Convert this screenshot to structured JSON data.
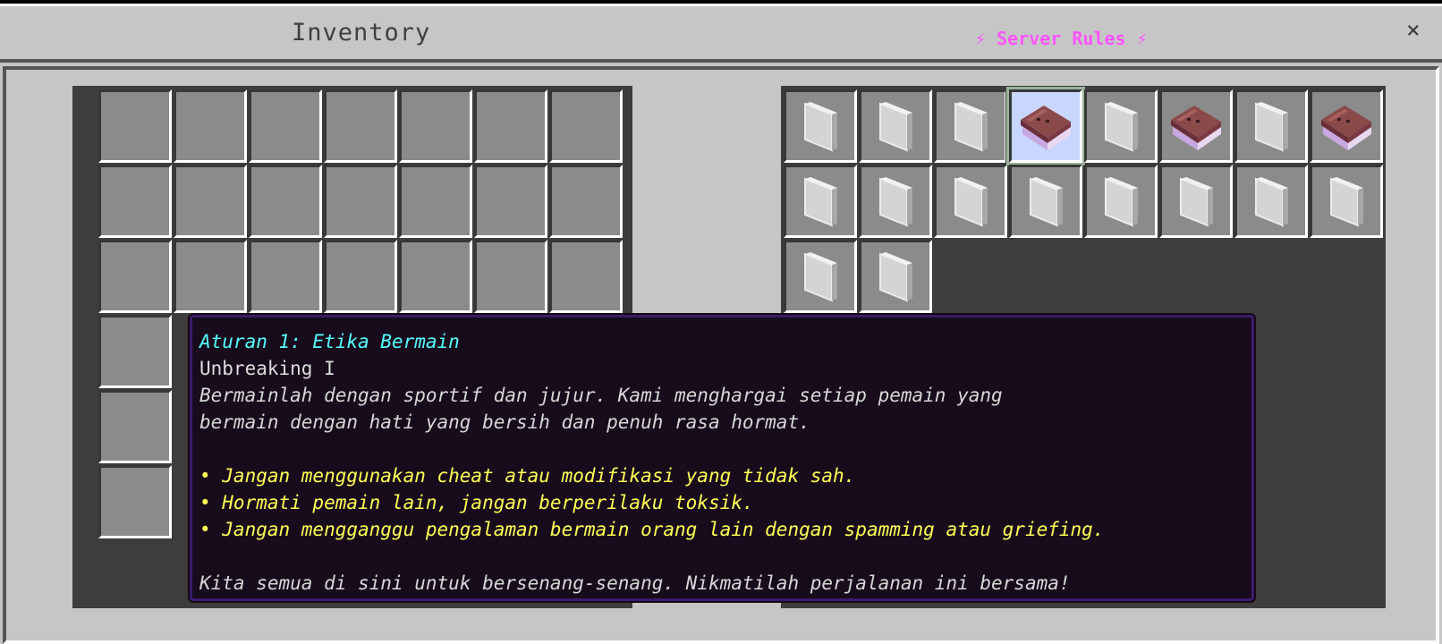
{
  "window": {
    "left_title": "Inventory",
    "right_title": "⚡ Server Rules ⚡",
    "close_symbol": "×"
  },
  "colors": {
    "window_bg": "#c6c6c6",
    "slot_bg": "#8b8b8b",
    "panel_bg": "#3d3d3d",
    "title_accent": "#ff55ff",
    "tooltip_bg": "#180c1c",
    "tooltip_title": "#55ffff",
    "tooltip_bullet": "#ffff55"
  },
  "inventory": {
    "rows": 6,
    "cols": 7,
    "items": []
  },
  "server_rules": {
    "slots": [
      {
        "item": "glass-pane-icon"
      },
      {
        "item": "glass-pane-icon"
      },
      {
        "item": "glass-pane-icon"
      },
      {
        "item": "enchanted-book-icon",
        "selected": true
      },
      {
        "item": "glass-pane-icon"
      },
      {
        "item": "enchanted-book-icon"
      },
      {
        "item": "glass-pane-icon"
      },
      {
        "item": "enchanted-book-icon"
      },
      {
        "item": "glass-pane-icon"
      },
      {
        "item": "glass-pane-icon"
      },
      {
        "item": "glass-pane-icon"
      },
      {
        "item": "glass-pane-icon"
      },
      {
        "item": "glass-pane-icon"
      },
      {
        "item": "glass-pane-icon"
      },
      {
        "item": "glass-pane-icon"
      },
      {
        "item": "glass-pane-icon"
      },
      {
        "item": "glass-pane-icon"
      },
      {
        "item": "glass-pane-icon"
      }
    ]
  },
  "tooltip": {
    "title": "Aturan 1: Etika Bermain",
    "enchantment": "Unbreaking I",
    "description": [
      "Bermainlah dengan sportif dan jujur. Kami menghargai setiap pemain yang",
      "bermain dengan hati yang bersih dan penuh rasa hormat."
    ],
    "bullets": [
      "• Jangan menggunakan cheat atau modifikasi yang tidak sah.",
      "• Hormati pemain lain, jangan berperilaku toksik.",
      "• Jangan mengganggu pengalaman bermain orang lain dengan spamming atau griefing."
    ],
    "footer": "Kita semua di sini untuk bersenang-senang. Nikmatilah perjalanan ini bersama!"
  }
}
